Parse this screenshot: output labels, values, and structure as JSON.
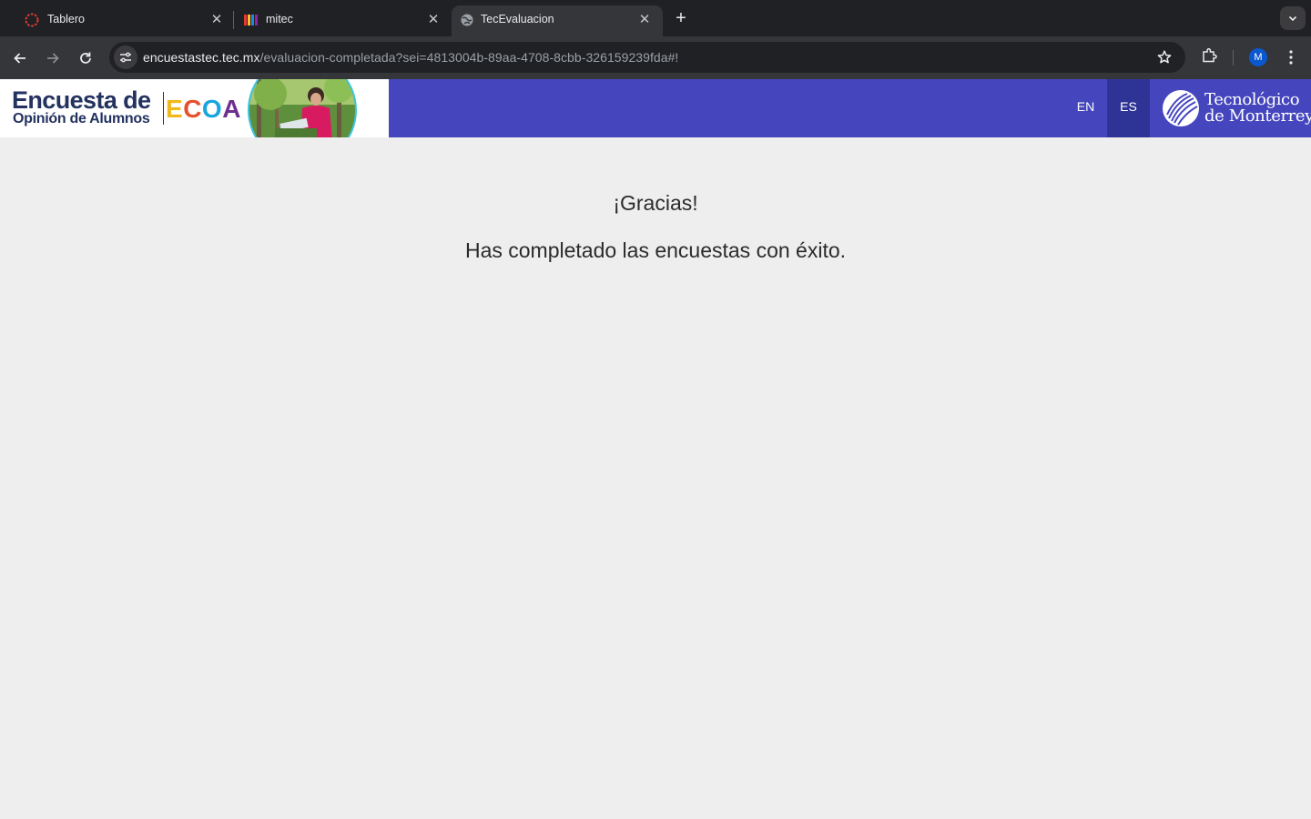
{
  "browser": {
    "tabs": [
      {
        "title": "Tablero",
        "favicon": "canvas-ring-icon",
        "active": false
      },
      {
        "title": "mitec",
        "favicon": "color-bars-icon",
        "active": false
      },
      {
        "title": "TecEvaluacion",
        "favicon": "globe-icon",
        "active": true
      }
    ],
    "close_glyph": "✕",
    "new_tab_glyph": "+",
    "url_host": "encuestastec.tec.mx",
    "url_path": "/evaluacion-completada?sei=4813004b-89aa-4708-8cbb-326159239fda#!",
    "profile_initial": "M",
    "colors": {
      "tabstrip": "#202124",
      "toolbar": "#35363a",
      "omnibox": "#202124",
      "avatar": "#0b57d0"
    }
  },
  "header": {
    "banner_title": "Encuesta de",
    "banner_subtitle": "Opinión de Alumnos",
    "ecoa": [
      "E",
      "C",
      "O",
      "A"
    ],
    "lang_en": "EN",
    "lang_es": "ES",
    "institution_line1": "Tecnológico",
    "institution_line2": "de Monterrey",
    "colors": {
      "bar": "#4546be",
      "active_lang": "#2e3495",
      "banner_text": "#23325f"
    }
  },
  "content": {
    "thanks": "¡Gracias!",
    "message": "Has completado las encuestas con éxito."
  }
}
